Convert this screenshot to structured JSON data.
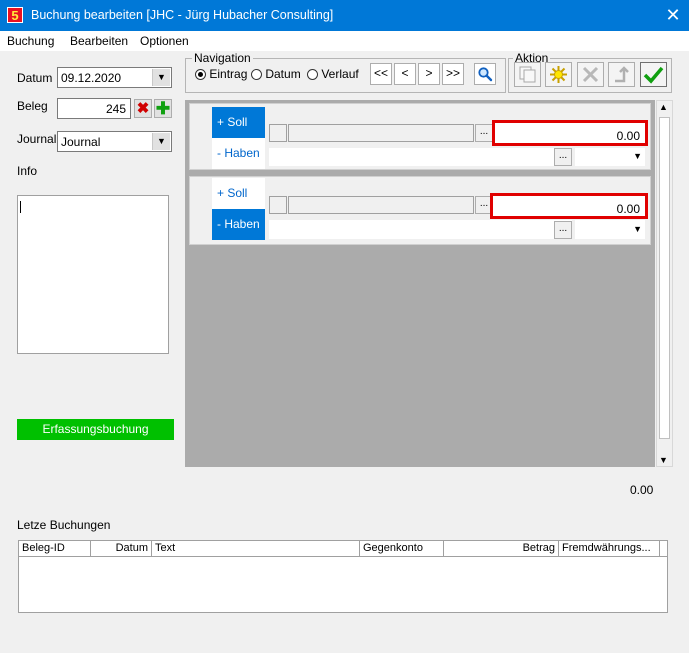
{
  "window": {
    "app_icon_text": "5",
    "title": "Buchung bearbeiten [JHC - Jürg Hubacher Consulting]",
    "close_glyph": "✕"
  },
  "menu": [
    "Buchung",
    "Bearbeiten",
    "Optionen"
  ],
  "left": {
    "datum_label": "Datum",
    "datum_value": "09.12.2020",
    "beleg_label": "Beleg",
    "beleg_value": "245",
    "journal_label": "Journal",
    "journal_value": "Journal",
    "info_label": "Info",
    "erfassung_button": "Erfassungsbuchung"
  },
  "navigation": {
    "title": "Navigation",
    "radios": [
      {
        "label": "Eintrag",
        "selected": true
      },
      {
        "label": "Datum",
        "selected": false
      },
      {
        "label": "Verlauf",
        "selected": false
      }
    ],
    "buttons": [
      "<<",
      "<",
      ">",
      ">>"
    ]
  },
  "aktion": {
    "title": "Aktion"
  },
  "entries": [
    {
      "soll_label": "+ Soll",
      "haben_label": "- Haben",
      "active": "soll",
      "amount": "0.00"
    },
    {
      "soll_label": "+ Soll",
      "haben_label": "- Haben",
      "active": "haben",
      "amount": "0.00"
    }
  ],
  "ellipsis": "...",
  "total": "0.00",
  "recent": {
    "title": "Letze Buchungen",
    "columns": [
      "Beleg-ID",
      "Datum",
      "Text",
      "Gegenkonto",
      "Betrag",
      "Fremdwährungs..."
    ]
  },
  "colors": {
    "titlebar": "#0078d7",
    "active_tab": "#0078d7",
    "erfassung_button": "#00c000",
    "amount_highlight": "#e00000"
  }
}
